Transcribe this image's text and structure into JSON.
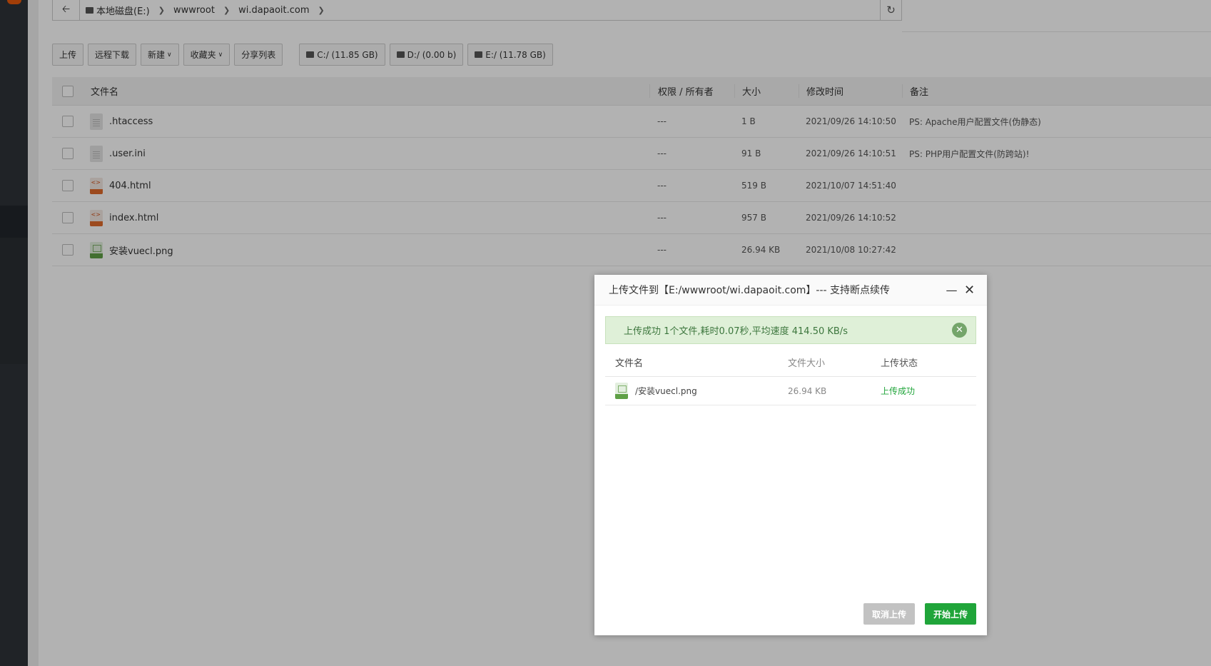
{
  "path_bar": {
    "crumbs": [
      "本地磁盘(E:)",
      "wwwroot",
      "wi.dapaoit.com"
    ]
  },
  "toolbar": {
    "upload": "上传",
    "remote_download": "远程下载",
    "new": "新建",
    "favorites": "收藏夹",
    "share_list": "分享列表",
    "disks": [
      "C:/ (11.85 GB)",
      "D:/ (0.00 b)",
      "E:/ (11.78 GB)"
    ]
  },
  "file_table": {
    "headers": {
      "name": "文件名",
      "perm": "权限 / 所有者",
      "size": "大小",
      "mtime": "修改时间",
      "note": "备注"
    },
    "rows": [
      {
        "icon": "text-file-icon",
        "name": ".htaccess",
        "perm": "---",
        "size": "1 B",
        "mtime": "2021/09/26 14:10:50",
        "note": "PS: Apache用户配置文件(伪静态)"
      },
      {
        "icon": "text-file-icon",
        "name": ".user.ini",
        "perm": "---",
        "size": "91 B",
        "mtime": "2021/09/26 14:10:51",
        "note": "PS: PHP用户配置文件(防跨站)!"
      },
      {
        "icon": "html-file-icon",
        "name": "404.html",
        "perm": "---",
        "size": "519 B",
        "mtime": "2021/10/07 14:51:40",
        "note": ""
      },
      {
        "icon": "html-file-icon",
        "name": "index.html",
        "perm": "---",
        "size": "957 B",
        "mtime": "2021/09/26 14:10:52",
        "note": ""
      },
      {
        "icon": "png-file-icon",
        "name": "安装vuecl.png",
        "perm": "---",
        "size": "26.94 KB",
        "mtime": "2021/10/08 10:27:42",
        "note": ""
      }
    ]
  },
  "upload_dialog": {
    "title": "上传文件到【E:/wwwroot/wi.dapaoit.com】--- 支持断点续传",
    "message": "上传成功 1个文件,耗时0.07秒,平均速度 414.50 KB/s",
    "headers": {
      "name": "文件名",
      "size": "文件大小",
      "status": "上传状态"
    },
    "files": [
      {
        "name": "/安装vuecl.png",
        "size": "26.94 KB",
        "status": "上传成功"
      }
    ],
    "cancel_label": "取消上传",
    "start_label": "开始上传"
  },
  "colors": {
    "sidebar": "#2f3339",
    "success_green": "#20a53a",
    "message_bg": "#dff0d8"
  }
}
